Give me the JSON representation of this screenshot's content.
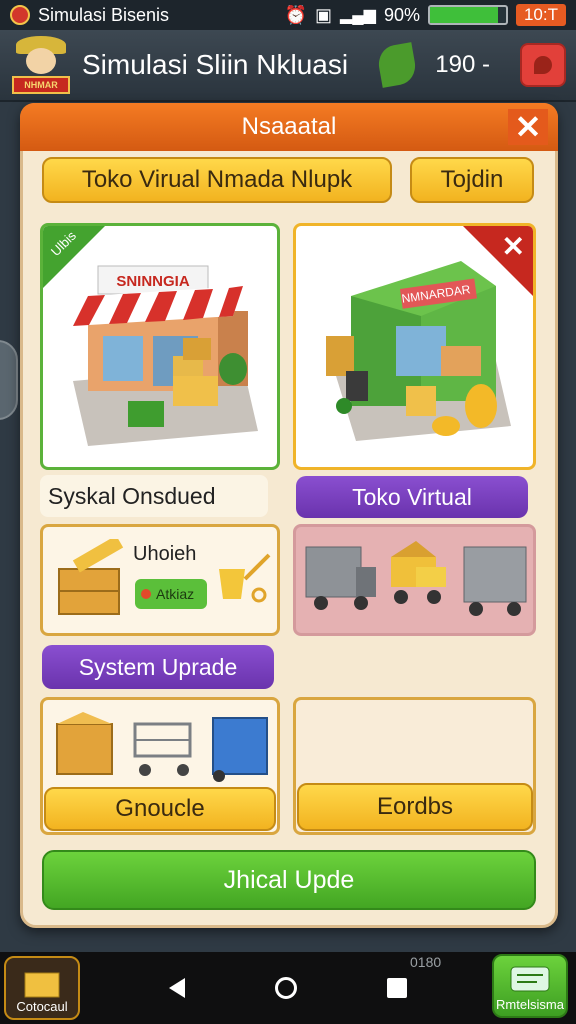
{
  "status_bar": {
    "app_name": "Simulasi Bisenis",
    "battery_percent": "90%",
    "battery_level": 0.9,
    "clock": "10:T"
  },
  "app_bar": {
    "title": "Simulasi Sliin Nkluasi",
    "logo_label": "NHMAR",
    "coins": "190 -"
  },
  "modal": {
    "title": "Nsaaatal",
    "close_icon": "✕",
    "top_buttons": [
      "Toko Virual Nmada Nlupk",
      "Tojdin"
    ],
    "card_left": {
      "ribbon": "Ulbis",
      "sign": "SNINNGIA",
      "caption": "Syskal Onsdued"
    },
    "card_right": {
      "sign": "NMNARDAR",
      "caption_button": "Toko Virtual"
    },
    "upgrade_card": {
      "title": "Uhoieh",
      "tag": "Atkiaz"
    },
    "system_button": "System Uprade",
    "bottom_left_button": "Gnoucle",
    "bottom_right_button": "Eordbs",
    "primary_button": "Jhical Upde"
  },
  "nav": {
    "left_corner_label": "Cotocaul",
    "right_corner_label": "Rmtelsisma",
    "aux_text": "0180"
  }
}
